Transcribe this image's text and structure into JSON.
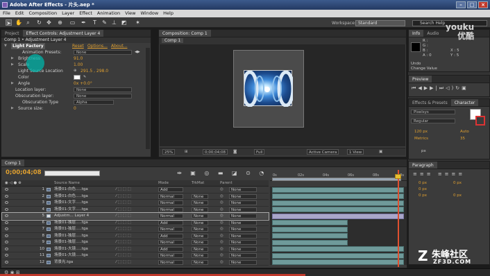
{
  "window": {
    "title": "Adobe After Effects - 片头.aep *"
  },
  "menu": [
    "File",
    "Edit",
    "Composition",
    "Layer",
    "Effect",
    "Animation",
    "View",
    "Window",
    "Help"
  ],
  "workspace": {
    "label": "Workspace:",
    "value": "Standard",
    "search_placeholder": "Search Help"
  },
  "left_tabs": [
    {
      "label": "Project"
    },
    {
      "label": "Effect Controls: Adjustment Layer 4"
    }
  ],
  "effect_controls": {
    "header": "Comp 1 • Adjustment Layer 4",
    "effect_name": "Light Factory",
    "reset": "Reset",
    "options": "Options...",
    "about": "About...",
    "animation_presets_label": "Animation Presets:",
    "animation_presets_value": "None",
    "properties": [
      {
        "label": "Brightness",
        "value": "91.0"
      },
      {
        "label": "Scale",
        "value": "1.00"
      },
      {
        "label": "Light Source Location",
        "value": "291.5 , 298.0"
      },
      {
        "label": "Color",
        "value": ""
      },
      {
        "label": "Angle",
        "value": "0x +0.0°"
      },
      {
        "label": "Location layer:",
        "value": "None"
      },
      {
        "label": "Obscuration layer:",
        "value": "None"
      },
      {
        "label": "Obscuration Type",
        "value": "Alpha"
      },
      {
        "label": "Source size:",
        "value": "0"
      }
    ]
  },
  "composition": {
    "tab": "Composition: Comp 1",
    "subtab": "Comp 1",
    "viewer_bar": {
      "zoom": "25%",
      "timecode": "0;00;04;08",
      "resolution": "Full",
      "camera": "Active Camera",
      "views": "1 View"
    }
  },
  "right_panels": {
    "info": {
      "tabs": [
        "Info",
        "Audio"
      ],
      "lines": [
        "R :",
        "G :",
        "B :",
        "A : 0"
      ],
      "xy": [
        "X : 5",
        "Y : 5"
      ],
      "undo": "Undo",
      "change": "Change Value"
    },
    "preview": {
      "tab": "Preview"
    },
    "character": {
      "tabs": [
        "Effects & Presets",
        "Character"
      ],
      "font": "Pixelsys",
      "style": "Regular",
      "size": "120 px",
      "leading": "Auto",
      "kerning": "Metrics",
      "tracking": "35",
      "units": "px"
    },
    "paragraph": {
      "tab": "Paragraph",
      "values": [
        "0 px",
        "0 px",
        "0 px",
        "0 px",
        "0 px"
      ]
    }
  },
  "timeline": {
    "tab": "Comp 1",
    "time": "0;00;04;08",
    "columns": {
      "source": "Source Name",
      "mode": "Mode",
      "trkmat": "TrkMat",
      "parent": "Parent"
    },
    "ruler": [
      "0s",
      "02s",
      "04s",
      "06s",
      "08s",
      "10s"
    ],
    "layers": [
      {
        "num": "1",
        "name": "场景01-白色.....tga",
        "mode": "Add",
        "trk": "",
        "parent": "None",
        "bar_end": 0.98,
        "type": "footage"
      },
      {
        "num": "2",
        "name": "场景01-白色.....tga",
        "mode": "Normal",
        "trk": "None",
        "parent": "None",
        "bar_end": 0.98,
        "type": "footage"
      },
      {
        "num": "3",
        "name": "场景01-文字.....tga",
        "mode": "Normal",
        "trk": "None",
        "parent": "None",
        "bar_end": 0.98,
        "type": "footage"
      },
      {
        "num": "4",
        "name": "场景01-文字.....tga",
        "mode": "Normal",
        "trk": "None",
        "parent": "None",
        "bar_end": 0.98,
        "type": "footage"
      },
      {
        "num": "5",
        "name": "Adjustm... Layer 4",
        "mode": "Normal",
        "trk": "None",
        "parent": "None",
        "bar_end": 0.98,
        "type": "adj",
        "selected": true
      },
      {
        "num": "6",
        "name": "场景01-独层.....tga",
        "mode": "Add",
        "trk": "None",
        "parent": "None",
        "bar_end": 0.56,
        "type": "footage"
      },
      {
        "num": "7",
        "name": "场景01-独层.....tga",
        "mode": "Normal",
        "trk": "None",
        "parent": "None",
        "bar_end": 0.56,
        "type": "footage"
      },
      {
        "num": "8",
        "name": "场景01-独层.....tga",
        "mode": "Add",
        "trk": "None",
        "parent": "None",
        "bar_end": 0.56,
        "type": "footage"
      },
      {
        "num": "9",
        "name": "场景01-独层.....tga",
        "mode": "Normal",
        "trk": "None",
        "parent": "None",
        "bar_end": 0.56,
        "type": "footage"
      },
      {
        "num": "10",
        "name": "场景01-大镜.....tga",
        "mode": "Add",
        "trk": "None",
        "parent": "None",
        "bar_end": 0.98,
        "type": "footage"
      },
      {
        "num": "11",
        "name": "场景01-大镜.....tga",
        "mode": "Normal",
        "trk": "None",
        "parent": "None",
        "bar_end": 0.98,
        "type": "footage"
      },
      {
        "num": "12",
        "name": "背景光.tga",
        "mode": "Normal",
        "trk": "None",
        "parent": "None",
        "bar_end": 0.98,
        "type": "footage"
      }
    ]
  },
  "watermarks": {
    "youku_en": "youku",
    "youku_cn": "优酷",
    "zf3d_cn": "朱峰社区",
    "zf3d_en": "ZF3D.COM"
  }
}
